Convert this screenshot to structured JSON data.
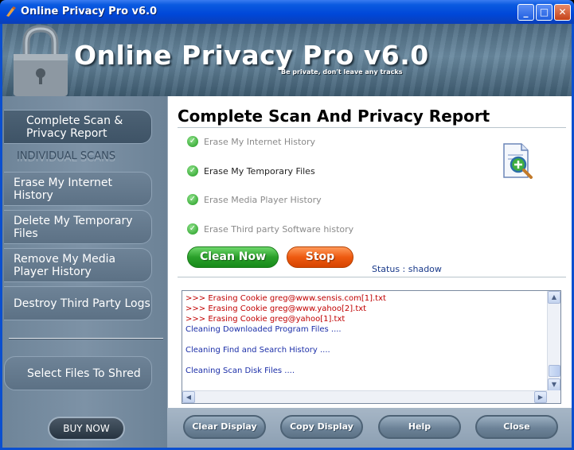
{
  "window": {
    "title": "Online Privacy Pro v6.0",
    "minimize_label": "_",
    "maximize_label": "□",
    "close_label": "✕"
  },
  "banner": {
    "title": "Online Privacy Pro v6.0",
    "tagline": "Be private, don't leave any tracks"
  },
  "sidebar": {
    "active_item": "Complete Scan & Privacy Report",
    "section_label": "INDIVIDUAL SCANS",
    "items": [
      "Erase My Internet History",
      "Delete My Temporary Files",
      "Remove My Media Player History",
      "Destroy Third Party Logs"
    ],
    "shred_item": "Select Files To Shred",
    "buy_now": "BUY NOW"
  },
  "main": {
    "title": "Complete Scan And Privacy Report",
    "checks": [
      {
        "label": "Erase My Internet History",
        "active": false
      },
      {
        "label": "Erase My Temporary Files",
        "active": true
      },
      {
        "label": "Erase Media Player History",
        "active": false
      },
      {
        "label": "Erase Third party Software history",
        "active": false
      }
    ],
    "clean_now": "Clean Now",
    "stop": "Stop",
    "status": "Status : shadow"
  },
  "log": {
    "lines": [
      {
        "text": ">>> Erasing Cookie greg@www.sensis.com[1].txt",
        "color": "red"
      },
      {
        "text": ">>> Erasing Cookie greg@www.yahoo[2].txt",
        "color": "red"
      },
      {
        "text": ">>> Erasing Cookie greg@yahoo[1].txt",
        "color": "red"
      },
      {
        "text": "Cleaning Downloaded Program Files ....",
        "color": "blue"
      },
      {
        "text": "",
        "color": "blue"
      },
      {
        "text": "Cleaning Find and Search History ....",
        "color": "blue"
      },
      {
        "text": "",
        "color": "blue"
      },
      {
        "text": "Cleaning Scan Disk Files ....",
        "color": "blue"
      }
    ]
  },
  "bottom": {
    "clear_display": "Clear Display",
    "copy_display": "Copy Display",
    "help": "Help",
    "close": "Close"
  },
  "colors": {
    "titlebar": "#0047d8",
    "clean_now": "#2aa02a",
    "stop": "#ee5a10",
    "log_red": "#c00000",
    "log_blue": "#1b2ea8"
  }
}
